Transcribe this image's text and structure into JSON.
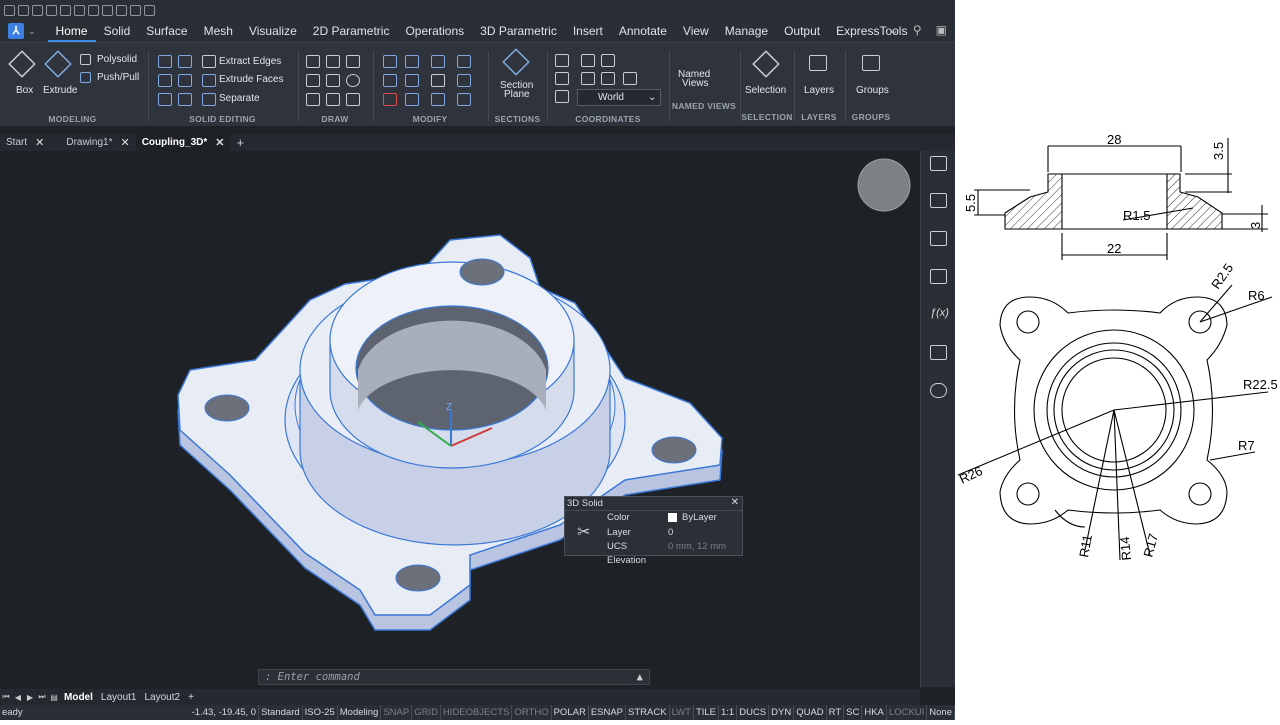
{
  "ribbon_tabs": [
    "Home",
    "Solid",
    "Surface",
    "Mesh",
    "Visualize",
    "2D Parametric",
    "Operations",
    "3D Parametric",
    "Insert",
    "Annotate",
    "View",
    "Manage",
    "Output",
    "ExpressTools"
  ],
  "ribbon": {
    "modeling": {
      "label": "MODELING",
      "box": "Box",
      "extrude": "Extrude",
      "polysolid": "Polysolid",
      "pushpull": "Push/Pull"
    },
    "solid_editing": {
      "label": "SOLID EDITING",
      "extract_edges": "Extract Edges",
      "extrude_faces": "Extrude Faces",
      "separate": "Separate"
    },
    "draw": {
      "label": "DRAW"
    },
    "modify": {
      "label": "MODIFY"
    },
    "sections": {
      "label": "SECTIONS",
      "section_plane_1": "Section",
      "section_plane_2": "Plane"
    },
    "coordinates": {
      "label": "COORDINATES",
      "ucs": "World"
    },
    "named_views": {
      "label": "NAMED VIEWS",
      "btn_1": "Named",
      "btn_2": "Views"
    },
    "selection": {
      "label": "SELECTION",
      "btn": "Selection"
    },
    "layers": {
      "label": "LAYERS",
      "btn": "Layers"
    },
    "groups": {
      "label": "GROUPS",
      "btn": "Groups"
    }
  },
  "doc_tabs": [
    "Start",
    "Drawing1*",
    "Coupling_3D*"
  ],
  "popup": {
    "title": "3D Solid",
    "color_key": "Color",
    "color_val": "ByLayer",
    "layer_key": "Layer",
    "layer_val": "0",
    "ucs_key": "UCS Elevation",
    "ucs_val": "0 mm, 12 mm"
  },
  "command_placeholder": ": Enter command",
  "layout_tabs": [
    "Model",
    "Layout1",
    "Layout2"
  ],
  "status": {
    "ready": "eady",
    "coords": "-1.43, -19.45, 0",
    "items": [
      "Standard",
      "ISO-25",
      "Modeling",
      "SNAP",
      "GRID",
      "HIDEOBJECTS",
      "ORTHO",
      "POLAR",
      "ESNAP",
      "STRACK",
      "LWT",
      "TILE",
      "1:1",
      "DUCS",
      "DYN",
      "QUAD",
      "RT",
      "SC",
      "HKA",
      "LOCKUI",
      "None"
    ]
  },
  "drawing": {
    "dims": {
      "w28": "28",
      "h35": "3.5",
      "h55": "5.5",
      "r15": "R1.5",
      "h3": "3",
      "w22": "22",
      "r25": "R2.5",
      "r6": "R6",
      "r225": "R22.5",
      "r7": "R7",
      "r26": "R26",
      "r11": "R11",
      "r14": "R14",
      "r17": "R17"
    }
  },
  "colors": {
    "accent": "#3d8ee8",
    "model_face": "#e8ecf5",
    "model_edge": "#3a78d8"
  }
}
